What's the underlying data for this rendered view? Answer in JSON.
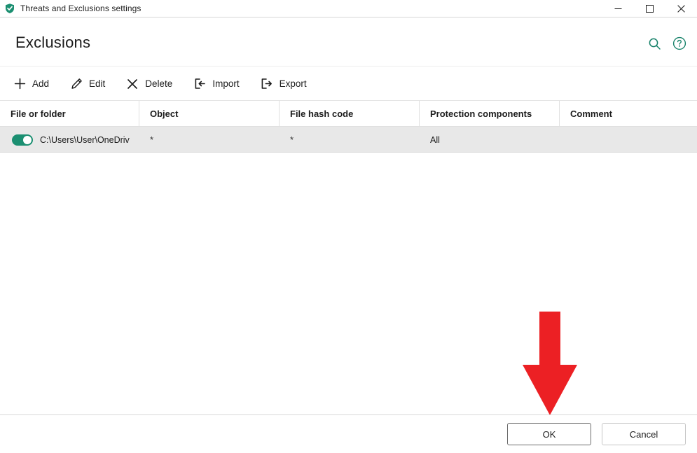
{
  "window": {
    "title": "Threats and Exclusions settings",
    "icon": "shield-check-icon",
    "controls": {
      "minimize": "minimize-icon",
      "maximize": "maximize-icon",
      "close": "close-icon"
    }
  },
  "header": {
    "title": "Exclusions",
    "search_icon": "search-icon",
    "help_icon": "help-circle-icon"
  },
  "toolbar": {
    "items": [
      {
        "label": "Add",
        "icon": "plus-icon"
      },
      {
        "label": "Edit",
        "icon": "pencil-icon"
      },
      {
        "label": "Delete",
        "icon": "close-x-icon"
      },
      {
        "label": "Import",
        "icon": "import-arrow-icon"
      },
      {
        "label": "Export",
        "icon": "export-arrow-icon"
      }
    ]
  },
  "table": {
    "columns": [
      {
        "label": "File or folder"
      },
      {
        "label": "Object"
      },
      {
        "label": "File hash code"
      },
      {
        "label": "Protection components"
      },
      {
        "label": "Comment"
      }
    ],
    "rows": [
      {
        "enabled": true,
        "toggle_icon": "toggle-on-icon",
        "file_or_folder": "C:\\Users\\User\\OneDriv",
        "object": "*",
        "file_hash_code": "*",
        "protection_components": "All",
        "comment": ""
      }
    ]
  },
  "annotation": {
    "arrow_icon": "red-down-arrow-icon",
    "color": "#ec2024",
    "points_at": "OK"
  },
  "footer": {
    "ok_label": "OK",
    "cancel_label": "Cancel"
  },
  "colors": {
    "accent_green": "#17826a",
    "toggle_green": "#1b8f71",
    "row_background": "#e8e8e8",
    "annotation_red": "#ec2024"
  }
}
